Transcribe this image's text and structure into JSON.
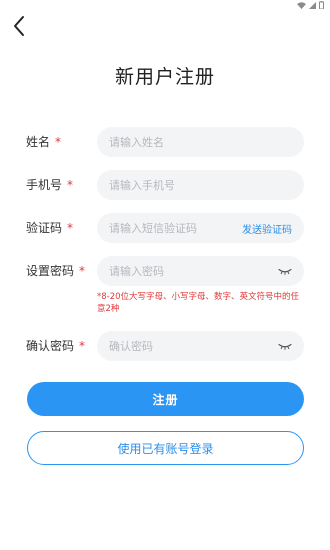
{
  "header": {
    "back_icon": "chevron-left-icon",
    "title": "新用户注册"
  },
  "status_bar": {
    "icons": [
      "wifi-icon",
      "signal-icon",
      "battery-icon"
    ]
  },
  "form": {
    "name": {
      "label": "姓名",
      "required": "*",
      "placeholder": "请输入姓名"
    },
    "phone": {
      "label": "手机号",
      "required": "*",
      "placeholder": "请输入手机号"
    },
    "code": {
      "label": "验证码",
      "required": "*",
      "placeholder": "请输入短信验证码",
      "send_label": "发送验证码"
    },
    "password": {
      "label": "设置密码",
      "required": "*",
      "placeholder": "请输入密码",
      "hint": "*8-20位大写字母、小写字母、数字、英文符号中的任意2种"
    },
    "confirm": {
      "label": "确认密码",
      "required": "*",
      "placeholder": "确认密码"
    }
  },
  "actions": {
    "register_label": "注册",
    "login_label": "使用已有账号登录"
  },
  "colors": {
    "accent": "#2b95f3",
    "required": "#e03a3a",
    "field_bg": "#f3f4f6"
  }
}
